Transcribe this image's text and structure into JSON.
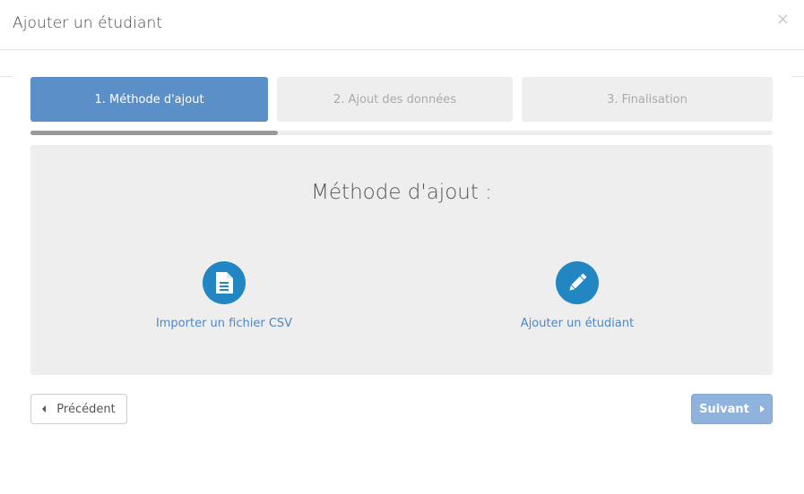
{
  "modal": {
    "title": "Ajouter un étudiant",
    "close_symbol": "×"
  },
  "steps": [
    {
      "label": "1. Méthode d'ajout",
      "active": true
    },
    {
      "label": "2. Ajout des données",
      "active": false
    },
    {
      "label": "3. Finalisation",
      "active": false
    }
  ],
  "progress": {
    "fraction": 0.333
  },
  "panel": {
    "title": "Méthode d'ajout :",
    "options": [
      {
        "label": "Importer un fichier CSV",
        "icon": "file-text-icon"
      },
      {
        "label": "Ajouter un étudiant",
        "icon": "pencil-icon"
      }
    ]
  },
  "buttons": {
    "previous": "Précédent",
    "next": "Suivant"
  },
  "colors": {
    "accent": "#5b8fc7",
    "icon_circle": "#2286c3",
    "link": "#4f86c6",
    "next_button": "#8fb3dc"
  }
}
